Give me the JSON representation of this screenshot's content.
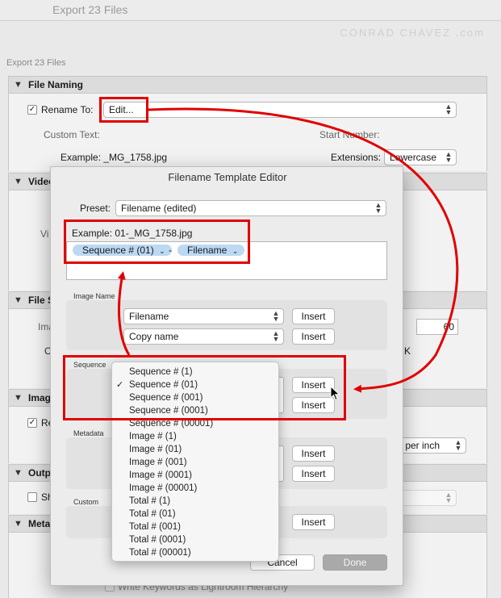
{
  "window": {
    "title": "Export 23 Files",
    "subtitle": "Export 23 Files",
    "watermark": "CONRAD CHAVEZ .com"
  },
  "file_naming": {
    "section_label": "File Naming",
    "rename_to_label": "Rename To:",
    "rename_value": "Edit...",
    "custom_text_label": "Custom Text:",
    "start_number_label": "Start Number:",
    "example_text": "Example: _MG_1758.jpg",
    "extensions_label": "Extensions:",
    "extensions_value": "Lowercase"
  },
  "background_sections": {
    "video": "Video",
    "file_settings": "File S",
    "image_sizing": "Imag",
    "output": "Outp",
    "metadata": "Meta",
    "left_fragments": [
      "Vi",
      "Ima",
      "C",
      "Re",
      "Sh"
    ],
    "quality_value": "60",
    "k_label": "K",
    "resolution_unit": "s per inch",
    "bottom_text": "Write Keywords as Lightroom Hierarchy"
  },
  "dialog": {
    "title": "Filename Template Editor",
    "preset_label": "Preset:",
    "preset_value": "Filename (edited)",
    "example_text": "Example:  01-_MG_1758.jpg",
    "tokens": [
      "Sequence # (01)",
      "Filename"
    ],
    "token_separator": "-",
    "image_name_label": "Image Name",
    "image_name_rows": [
      "Filename",
      "Copy name"
    ],
    "sequence_label": "Sequence",
    "metadata_label": "Metadata",
    "custom_label": "Custom",
    "insert_label": "Insert",
    "cancel_label": "Cancel",
    "done_label": "Done"
  },
  "sequence_menu": {
    "selected_index": 1,
    "items": [
      "Sequence # (1)",
      "Sequence # (01)",
      "Sequence # (001)",
      "Sequence # (0001)",
      "Sequence # (00001)",
      "Image # (1)",
      "Image # (01)",
      "Image # (001)",
      "Image # (0001)",
      "Image # (00001)",
      "Total # (1)",
      "Total # (01)",
      "Total # (001)",
      "Total # (0001)",
      "Total # (00001)"
    ]
  },
  "colors": {
    "annotation_red": "#e10000",
    "token_blue": "#bcd9f3",
    "dialog_bg": "#ececec"
  }
}
